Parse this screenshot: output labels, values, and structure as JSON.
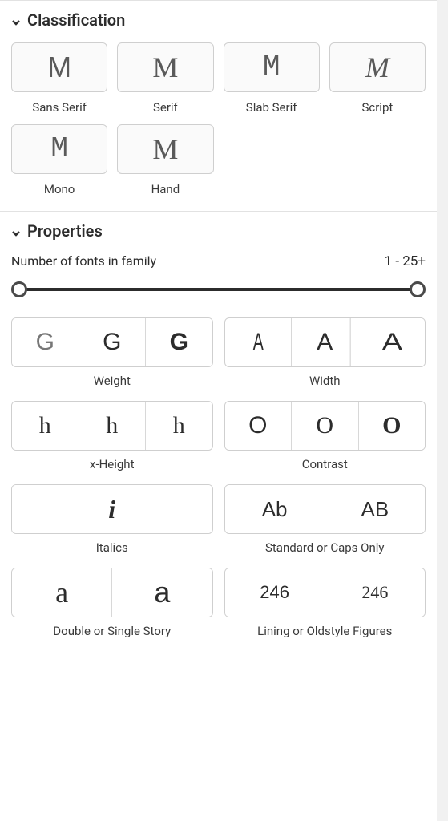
{
  "classification": {
    "title": "Classification",
    "items": [
      {
        "label": "Sans Serif",
        "glyph": "M",
        "style": "glyph-sans"
      },
      {
        "label": "Serif",
        "glyph": "M",
        "style": "glyph-serif"
      },
      {
        "label": "Slab Serif",
        "glyph": "M",
        "style": "glyph-slab"
      },
      {
        "label": "Script",
        "glyph": "M",
        "style": "glyph-script"
      },
      {
        "label": "Mono",
        "glyph": "M",
        "style": "glyph-mono"
      },
      {
        "label": "Hand",
        "glyph": "M",
        "style": "glyph-hand"
      }
    ]
  },
  "properties": {
    "title": "Properties",
    "familyCount": {
      "label": "Number of fonts in family",
      "range": "1 - 25+"
    },
    "groups": {
      "weight": {
        "label": "Weight",
        "opts": [
          "G",
          "G",
          "G"
        ],
        "classes": [
          "w-thin",
          "w-reg",
          "w-bold"
        ]
      },
      "width": {
        "label": "Width",
        "opts": [
          "A",
          "A",
          "A"
        ],
        "classes": [
          "wd-narrow",
          "wd-reg",
          "wd-wide"
        ]
      },
      "xheight": {
        "label": "x-Height",
        "opts": [
          "h",
          "h",
          "h"
        ],
        "classes": [
          "xh-low",
          "xh-mid",
          "xh-high"
        ]
      },
      "contrast": {
        "label": "Contrast",
        "opts": [
          "O",
          "O",
          "O"
        ],
        "classes": [
          "ct-low",
          "ct-mid",
          "ct-high"
        ]
      },
      "italics": {
        "label": "Italics",
        "opts": [
          "i"
        ],
        "classes": [
          "it-glyph"
        ]
      },
      "caps": {
        "label": "Standard or Caps Only",
        "opts": [
          "Ab",
          "AB"
        ],
        "classes": [
          "ab-std",
          "ab-caps"
        ]
      },
      "story": {
        "label": "Double or Single Story",
        "opts": [
          "a",
          "a"
        ],
        "classes": [
          "story-double",
          "story-single"
        ]
      },
      "figures": {
        "label": "Lining or Oldstyle Figures",
        "opts": [
          "246",
          "246"
        ],
        "classes": [
          "fig-lining",
          "fig-old"
        ]
      }
    }
  }
}
